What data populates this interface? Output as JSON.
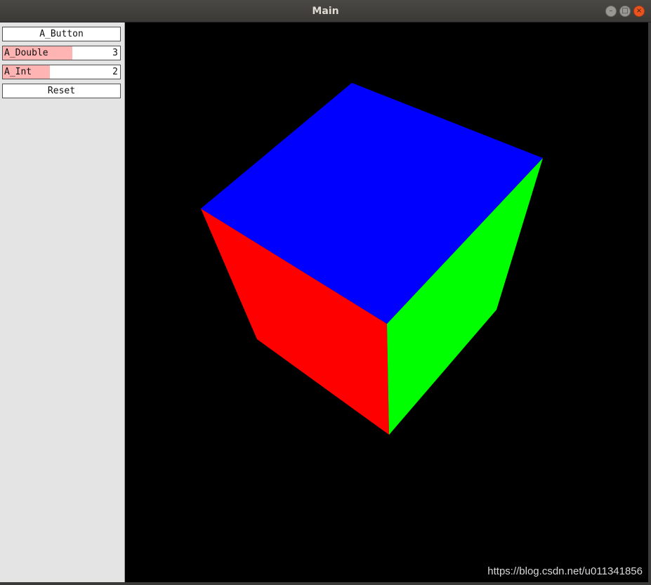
{
  "window": {
    "title": "Main",
    "controls": {
      "minimize": "minimize-icon",
      "maximize": "maximize-icon",
      "close": "close-icon"
    }
  },
  "panel": {
    "button": {
      "label": "A_Button"
    },
    "double_slider": {
      "label": "A_Double",
      "value": "3",
      "fill_fraction": 0.59,
      "fill_color": "#ffb4b4"
    },
    "int_slider": {
      "label": "A_Int",
      "value": "2",
      "fill_fraction": 0.4,
      "fill_color": "#ffb4b4"
    },
    "reset": {
      "label": "Reset"
    }
  },
  "scene": {
    "background": "#000000",
    "faces": {
      "top": "#0000ff",
      "left": "#ff0000",
      "right": "#00ff00"
    }
  },
  "watermark": "https://blog.csdn.net/u011341856"
}
